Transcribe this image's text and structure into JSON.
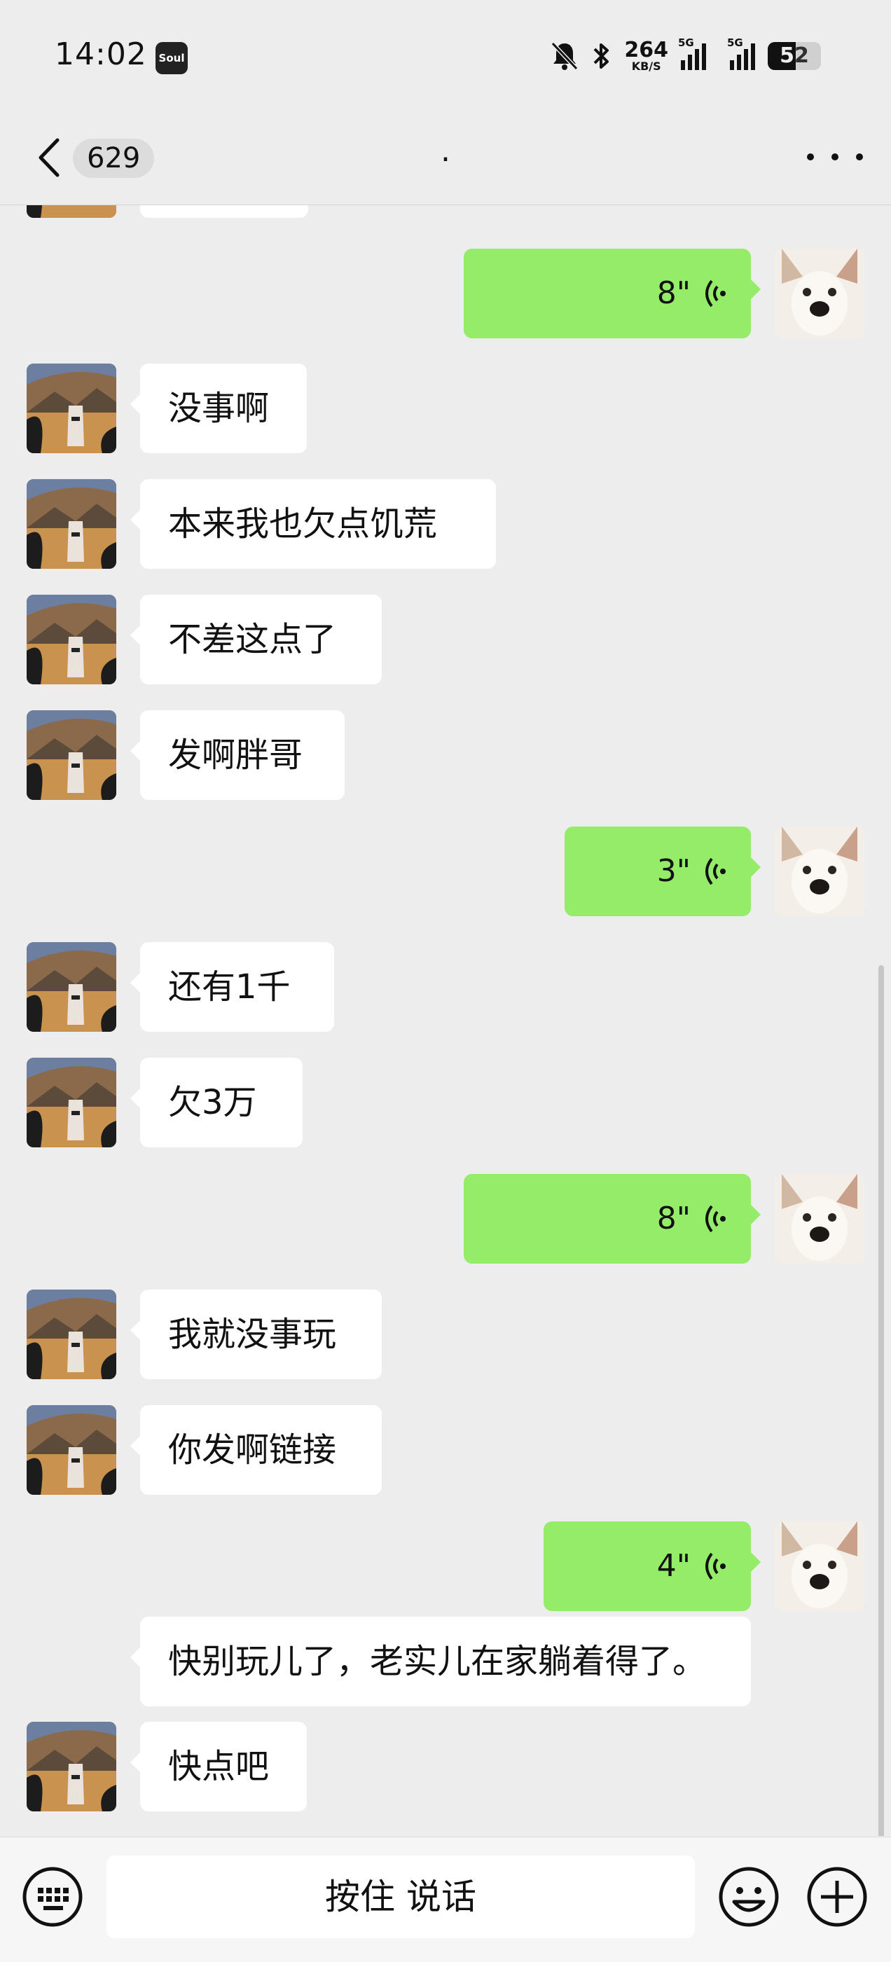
{
  "status_bar": {
    "time": "14:02",
    "app_badge": "Soul",
    "speed_value": "264",
    "speed_unit": "KB/S",
    "network1": "5G",
    "network2": "5G",
    "battery": "52",
    "battery_level": 0.52
  },
  "nav": {
    "unread_count": "629",
    "title": "."
  },
  "messages": [
    {
      "side": "in",
      "type": "text",
      "text": "没事啊"
    },
    {
      "side": "in",
      "type": "text",
      "text": "本来我也欠点饥荒"
    },
    {
      "side": "in",
      "type": "text",
      "text": "不差这点了"
    },
    {
      "side": "in",
      "type": "text",
      "text": "发啊胖哥"
    },
    {
      "side": "out",
      "type": "voice",
      "duration": "3\""
    },
    {
      "side": "in",
      "type": "text",
      "text": "还有1千"
    },
    {
      "side": "in",
      "type": "text",
      "text": "欠3万"
    },
    {
      "side": "out",
      "type": "voice",
      "duration": "8\""
    },
    {
      "side": "in",
      "type": "text",
      "text": "我就没事玩"
    },
    {
      "side": "in",
      "type": "text",
      "text": "你发啊链接"
    },
    {
      "side": "out",
      "type": "voice",
      "duration": "4\""
    },
    {
      "side": "in",
      "type": "text",
      "text": "快别玩儿了，老实儿在家躺着得了。"
    },
    {
      "side": "in",
      "type": "text",
      "text": "快点吧"
    }
  ],
  "top_voice": {
    "duration": "8\""
  },
  "input_bar": {
    "hold_to_talk": "按住 说话"
  },
  "colors": {
    "background": "#ededed",
    "outgoing_bubble": "#95ec69",
    "incoming_bubble": "#ffffff"
  }
}
